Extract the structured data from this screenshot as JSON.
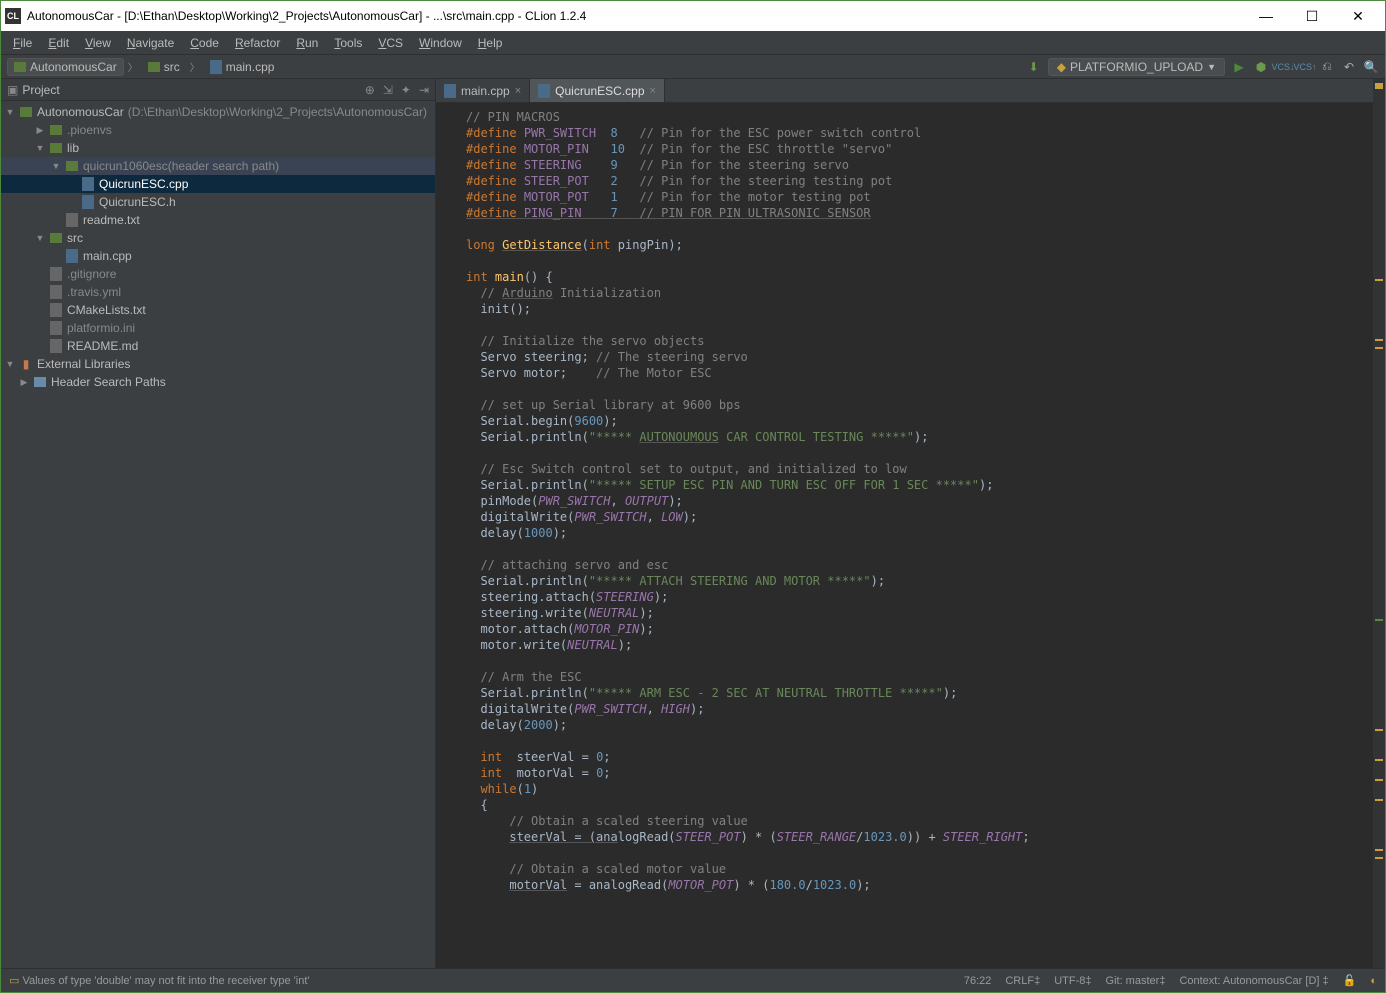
{
  "window": {
    "title": "AutonomousCar - [D:\\Ethan\\Desktop\\Working\\2_Projects\\AutonomousCar] - ...\\src\\main.cpp - CLion 1.2.4",
    "app_icon_text": "CL"
  },
  "menu": {
    "items": [
      "File",
      "Edit",
      "View",
      "Navigate",
      "Code",
      "Refactor",
      "Run",
      "Tools",
      "VCS",
      "Window",
      "Help"
    ]
  },
  "breadcrumb": {
    "items": [
      "AutonomousCar",
      "src",
      "main.cpp"
    ]
  },
  "run_config": {
    "label": "PLATFORMIO_UPLOAD"
  },
  "project_panel": {
    "title": "Project",
    "root": {
      "name": "AutonomousCar",
      "path": "(D:\\Ethan\\Desktop\\Working\\2_Projects\\AutonomousCar)"
    },
    "tree": [
      {
        "name": ".pioenvs",
        "type": "folder-grey",
        "indent": 2,
        "arrow": "▶"
      },
      {
        "name": "lib",
        "type": "folder",
        "indent": 2,
        "arrow": "▼"
      },
      {
        "name": "quicrun1060esc",
        "suffix": "(header search path)",
        "type": "folder-grey",
        "indent": 3,
        "arrow": "▼",
        "selected": true
      },
      {
        "name": "QuicrunESC.cpp",
        "type": "cpp",
        "indent": 4,
        "highlighted": true
      },
      {
        "name": "QuicrunESC.h",
        "type": "h",
        "indent": 4
      },
      {
        "name": "readme.txt",
        "type": "txt",
        "indent": 3
      },
      {
        "name": "src",
        "type": "folder",
        "indent": 2,
        "arrow": "▼"
      },
      {
        "name": "main.cpp",
        "type": "cpp",
        "indent": 3
      },
      {
        "name": ".gitignore",
        "type": "file-grey",
        "indent": 2
      },
      {
        "name": ".travis.yml",
        "type": "file-grey",
        "indent": 2
      },
      {
        "name": "CMakeLists.txt",
        "type": "cmake",
        "indent": 2
      },
      {
        "name": "platformio.ini",
        "type": "file-grey",
        "indent": 2
      },
      {
        "name": "README.md",
        "type": "md",
        "indent": 2
      }
    ],
    "external_libs": "External Libraries",
    "header_search": "Header Search Paths"
  },
  "editor": {
    "tabs": [
      {
        "name": "main.cpp",
        "active": false
      },
      {
        "name": "QuicrunESC.cpp",
        "active": true
      }
    ],
    "code_lines": [
      {
        "t": "// PIN MACROS",
        "c": "cmt"
      },
      {
        "raw": "<span class='kw'>#define</span> <span class='mac'>PWR_SWITCH</span>  <span class='num'>8</span>   <span class='cmt'>// Pin for the ESC power switch control</span>"
      },
      {
        "raw": "<span class='kw'>#define</span> <span class='mac'>MOTOR_PIN</span>   <span class='num'>10</span>  <span class='cmt'>// Pin for the ESC throttle \"servo\"</span>"
      },
      {
        "raw": "<span class='kw'>#define</span> <span class='mac'>STEERING</span>    <span class='num'>9</span>   <span class='cmt'>// Pin for the steering servo</span>"
      },
      {
        "raw": "<span class='kw'>#define</span> <span class='mac'>STEER_POT</span>   <span class='num'>2</span>   <span class='cmt'>// Pin for the steering testing pot</span>"
      },
      {
        "raw": "<span class='kw'>#define</span> <span class='mac'>MOTOR_POT</span>   <span class='num'>1</span>   <span class='cmt'>// Pin for the motor testing pot</span>"
      },
      {
        "raw": "<span class='kw underline'>#define</span><span class='underline'> </span><span class='mac underline'>PING_PIN</span><span class='underline'>    </span><span class='num underline'>7</span><span class='underline'>   </span><span class='cmt underline'>// PIN FOR PIN ULTRASONIC SENSOR</span>"
      },
      {
        "t": ""
      },
      {
        "raw": "<span class='typ'>long</span> <span class='fn underline'>GetDistance</span>(<span class='typ'>int</span> pingPin);"
      },
      {
        "t": ""
      },
      {
        "raw": "<span class='typ'>int</span> <span class='fn'>main</span>() {"
      },
      {
        "raw": "  <span class='cmt'>// <span class='underline'>Arduino</span> Initialization</span>"
      },
      {
        "raw": "  init();"
      },
      {
        "t": ""
      },
      {
        "raw": "  <span class='cmt'>// Initialize the servo objects</span>"
      },
      {
        "raw": "  Servo steering; <span class='cmt'>// The steering servo</span>"
      },
      {
        "raw": "  Servo motor;    <span class='cmt'>// The Motor ESC</span>"
      },
      {
        "t": ""
      },
      {
        "raw": "  <span class='cmt'>// set up Serial library at 9600 bps</span>"
      },
      {
        "raw": "  Serial.begin(<span class='num'>9600</span>);"
      },
      {
        "raw": "  Serial.println(<span class='str'>\"***** <span class='underline'>AUTONOUMOUS</span> CAR CONTROL TESTING *****\"</span>);"
      },
      {
        "t": ""
      },
      {
        "raw": "  <span class='cmt'>// Esc Switch control set to output, and initialized to low</span>"
      },
      {
        "raw": "  Serial.println(<span class='str'>\"***** SETUP ESC PIN AND TURN ESC OFF FOR 1 SEC *****\"</span>);"
      },
      {
        "raw": "  pinMode(<span class='const'>PWR_SWITCH</span>, <span class='const'>OUTPUT</span>);"
      },
      {
        "raw": "  digitalWrite(<span class='const'>PWR_SWITCH</span>, <span class='const'>LOW</span>);"
      },
      {
        "raw": "  delay(<span class='num'>1000</span>);"
      },
      {
        "t": ""
      },
      {
        "raw": "  <span class='cmt'>// attaching servo and esc</span>"
      },
      {
        "raw": "  Serial.println(<span class='str'>\"***** ATTACH STEERING AND MOTOR *****\"</span>);"
      },
      {
        "raw": "  steering.attach(<span class='const'>STEERING</span>);"
      },
      {
        "raw": "  steering.write(<span class='const'>NEUTRAL</span>);"
      },
      {
        "raw": "  motor.attach(<span class='const'>MOTOR_PIN</span>);"
      },
      {
        "raw": "  motor.write(<span class='const'>NEUTRAL</span>);"
      },
      {
        "t": ""
      },
      {
        "raw": "  <span class='cmt'>// Arm the ESC</span>"
      },
      {
        "raw": "  Serial.println(<span class='str'>\"***** ARM ESC - 2 SEC AT NEUTRAL THROTTLE *****\"</span>);"
      },
      {
        "raw": "  digitalWrite(<span class='const'>PWR_SWITCH</span>, <span class='const'>HIGH</span>);"
      },
      {
        "raw": "  delay(<span class='num'>2000</span>);"
      },
      {
        "t": ""
      },
      {
        "raw": "  <span class='typ'>int</span>  steerVal = <span class='num'>0</span>;"
      },
      {
        "raw": "  <span class='typ'>int</span>  motorVal = <span class='num'>0</span>;"
      },
      {
        "raw": "  <span class='kw'>while</span>(<span class='num'>1</span>)"
      },
      {
        "raw": "  {"
      },
      {
        "raw": "      <span class='cmt'>// Obtain a scaled steering value</span>"
      },
      {
        "raw": "      <span class='underline'>steerVal = (ana</span>logRead(<span class='const'>STEER_POT</span>) * (<span class='const'>STEER_RANGE</span>/<span class='num'>1023.0</span>)) + <span class='const'>STEER_RIGHT</span>;"
      },
      {
        "t": ""
      },
      {
        "raw": "      <span class='cmt'>// Obtain a scaled motor value</span>"
      },
      {
        "raw": "      <span class='underline'>motorVal</span> = analogRead(<span class='const'>MOTOR_POT</span>) * (<span class='num'>180.0</span>/<span class='num'>1023.0</span>);"
      }
    ]
  },
  "status": {
    "message": "Values of type 'double' may not fit into the receiver type 'int'",
    "pos": "76:22",
    "eol": "CRLF",
    "enc": "UTF-8",
    "git": "Git: master",
    "context": "Context: AutonomousCar [D]"
  }
}
